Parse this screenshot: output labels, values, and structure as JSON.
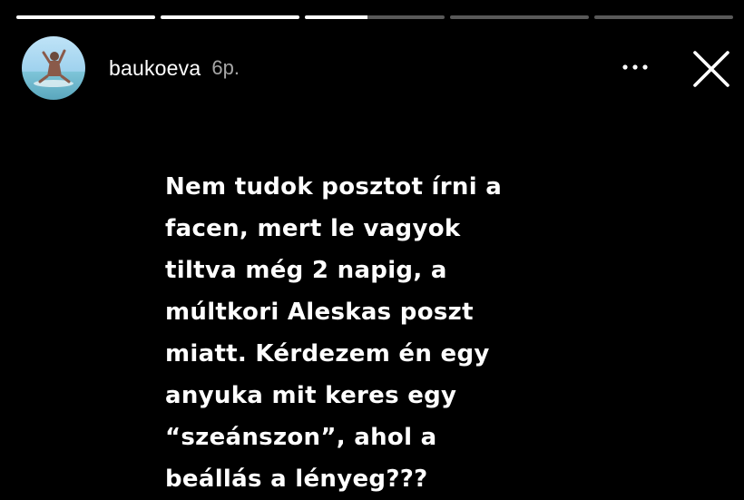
{
  "progress": {
    "segments": [
      1,
      1,
      0.45,
      0,
      0
    ]
  },
  "user": {
    "username": "baukoeva",
    "time_ago": "6p."
  },
  "icons": {
    "more": "more-horizontal-icon",
    "close": "close-icon"
  },
  "story": {
    "text": "Nem tudok posztot írni a\nfacen, mert le vagyok\ntiltva még 2 napig, a\nmúltkori Aleskas poszt\nmiatt. Kérdezem én egy\nanyuka mit keres egy\n“szeánszon”, ahol a\nbeállás a lényeg???"
  },
  "colors": {
    "background": "#000000",
    "text": "#ffffff",
    "progress_track": "rgba(255,255,255,0.35)"
  }
}
